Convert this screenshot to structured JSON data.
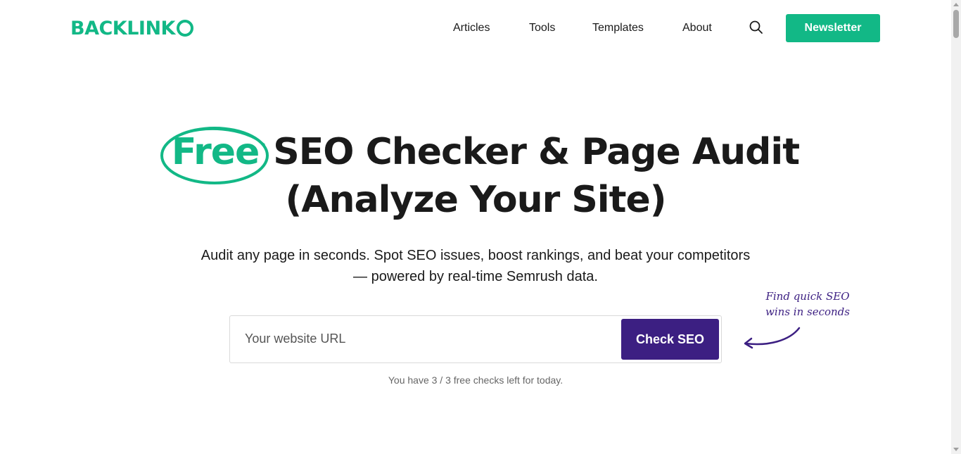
{
  "header": {
    "logo": "BACKLINK",
    "nav": [
      {
        "label": "Articles"
      },
      {
        "label": "Tools"
      },
      {
        "label": "Templates"
      },
      {
        "label": "About"
      }
    ],
    "search_icon": "search-icon",
    "newsletter_label": "Newsletter"
  },
  "hero": {
    "title_highlight": "Free",
    "title_line1_rest": "SEO Checker & Page Audit",
    "title_line2": "(Analyze Your Site)",
    "subtitle_line1": "Audit any page in seconds. Spot SEO issues, boost rankings, and beat your competitors",
    "subtitle_line2": "— powered by real-time Semrush data."
  },
  "form": {
    "url_value": "",
    "url_placeholder": "Your website URL",
    "submit_label": "Check SEO",
    "checks_left": "You have 3 / 3 free checks left for today."
  },
  "annotation": {
    "line1": "Find quick SEO",
    "line2": "wins in seconds"
  },
  "colors": {
    "brand_green": "#12b886",
    "brand_purple": "#3c1f82",
    "text": "#1a1a1a"
  }
}
